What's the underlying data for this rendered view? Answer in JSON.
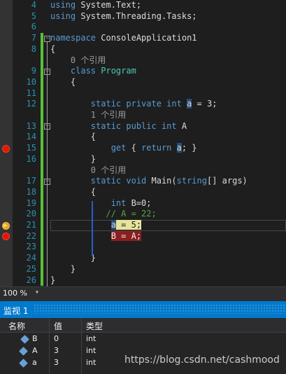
{
  "editor": {
    "line_numbers": [
      "4",
      "5",
      "6",
      "7",
      "8",
      "",
      "9",
      "10",
      "11",
      "12",
      "",
      "13",
      "14",
      "15",
      "16",
      "",
      "17",
      "18",
      "19",
      "20",
      "21",
      "22",
      "23",
      "24",
      "25",
      "26"
    ],
    "lines": [
      {
        "kind": "code",
        "parts": [
          {
            "t": "using ",
            "c": "kw"
          },
          {
            "t": "System.Text;"
          }
        ]
      },
      {
        "kind": "code",
        "parts": [
          {
            "t": "using ",
            "c": "kw"
          },
          {
            "t": "System.Threading.Tasks;"
          }
        ]
      },
      {
        "kind": "code",
        "parts": []
      },
      {
        "kind": "code",
        "parts": [
          {
            "t": "namespace ",
            "c": "kw"
          },
          {
            "t": "ConsoleApplication1"
          }
        ]
      },
      {
        "kind": "code",
        "parts": [
          {
            "t": "{"
          }
        ]
      },
      {
        "kind": "ref",
        "parts": [
          {
            "t": "    0 个引用",
            "c": "ref"
          }
        ]
      },
      {
        "kind": "code",
        "parts": [
          {
            "t": "    class ",
            "c": "kw"
          },
          {
            "t": "Program",
            "c": "ty"
          }
        ]
      },
      {
        "kind": "code",
        "parts": [
          {
            "t": "    {"
          }
        ]
      },
      {
        "kind": "code",
        "parts": []
      },
      {
        "kind": "code",
        "parts": [
          {
            "t": "        static private int ",
            "c": "kw"
          },
          {
            "t": "a",
            "c": "hl"
          },
          {
            "t": " = 3;"
          }
        ]
      },
      {
        "kind": "ref",
        "parts": [
          {
            "t": "        1 个引用",
            "c": "ref"
          }
        ]
      },
      {
        "kind": "code",
        "parts": [
          {
            "t": "        static public int ",
            "c": "kw"
          },
          {
            "t": "A"
          }
        ]
      },
      {
        "kind": "code",
        "parts": [
          {
            "t": "        {"
          }
        ]
      },
      {
        "kind": "code",
        "parts": [
          {
            "t": "            get ",
            "c": "kw"
          },
          {
            "t": "{ "
          },
          {
            "t": "return ",
            "c": "kw"
          },
          {
            "t": "a",
            "c": "hl"
          },
          {
            "t": "; }"
          }
        ]
      },
      {
        "kind": "code",
        "parts": [
          {
            "t": "        }"
          }
        ]
      },
      {
        "kind": "ref",
        "parts": [
          {
            "t": "        0 个引用",
            "c": "ref"
          }
        ]
      },
      {
        "kind": "code",
        "parts": [
          {
            "t": "        static void ",
            "c": "kw"
          },
          {
            "t": "Main("
          },
          {
            "t": "string",
            "c": "kw"
          },
          {
            "t": "[] args)"
          }
        ]
      },
      {
        "kind": "code",
        "parts": [
          {
            "t": "        {"
          }
        ]
      },
      {
        "kind": "code",
        "parts": [
          {
            "t": "            int ",
            "c": "kw"
          },
          {
            "t": "B=0;"
          }
        ]
      },
      {
        "kind": "code",
        "parts": [
          {
            "t": "           // A = 22;",
            "c": "cm"
          }
        ]
      },
      {
        "kind": "code",
        "parts": [
          {
            "t": "            a = 5;",
            "c": "cur"
          }
        ]
      },
      {
        "kind": "code",
        "parts": [
          {
            "t": "            B = A;",
            "c": "bpline"
          }
        ]
      },
      {
        "kind": "code",
        "parts": []
      },
      {
        "kind": "code",
        "parts": [
          {
            "t": "        }"
          }
        ]
      },
      {
        "kind": "code",
        "parts": [
          {
            "t": "    }"
          }
        ]
      },
      {
        "kind": "code",
        "parts": [
          {
            "t": "}"
          }
        ]
      }
    ],
    "breakpoints": [
      "15",
      "21",
      "22"
    ],
    "current_line": "21",
    "zoom": "100 %"
  },
  "watch": {
    "title": "监视 1",
    "columns": [
      "名称",
      "值",
      "类型"
    ],
    "rows": [
      {
        "name": "B",
        "value": "0",
        "type": "int",
        "icon": "local-variable-icon"
      },
      {
        "name": "A",
        "value": "3",
        "type": "int",
        "icon": "property-icon"
      },
      {
        "name": "a",
        "value": "3",
        "type": "int",
        "icon": "field-icon"
      }
    ]
  },
  "watermark": "https://blog.csdn.net/cashmood",
  "colors": {
    "keyword": "#569cd6",
    "type": "#4ec9b0",
    "comment": "#57a64a",
    "linenumber": "#2b91af",
    "breakpoint": "#e51400",
    "watch_title_bg": "#007acc"
  }
}
